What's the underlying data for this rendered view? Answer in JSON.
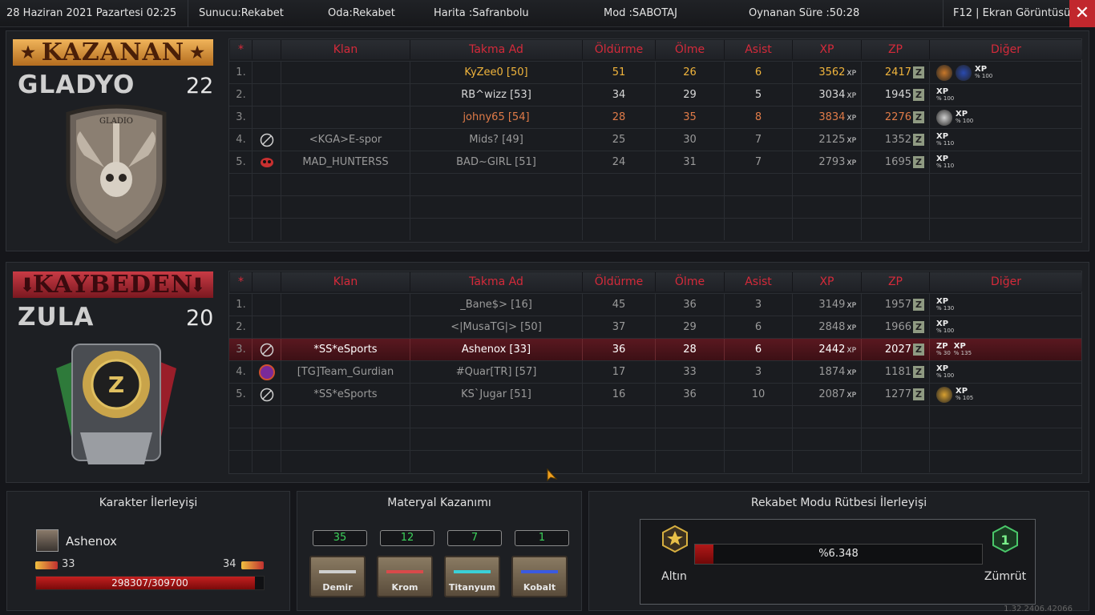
{
  "topbar": {
    "date": "28 Haziran 2021 Pazartesi 02:25",
    "server": "Sunucu:Rekabet",
    "room": "Oda:Rekabet",
    "map": "Harita :Safranbolu",
    "mode": "Mod :SABOTAJ",
    "time": "Oynanan Süre :50:28",
    "screenshot": "F12 | Ekran Görüntüsü",
    "close": "✕"
  },
  "headers": {
    "star": "*",
    "clan": "Klan",
    "nick": "Takma Ad",
    "kills": "Öldürme",
    "deaths": "Ölme",
    "assists": "Asist",
    "xp": "XP",
    "zp": "ZP",
    "other": "Diğer"
  },
  "winner": {
    "banner": "KAZANAN",
    "team": "GLADYO",
    "score": "22",
    "emblem_text": "GLADIO",
    "rows": [
      {
        "n": "1.",
        "clan": "",
        "nick": "KyZee0 [50]",
        "k": "51",
        "d": "26",
        "a": "6",
        "xp": "3562",
        "zp": "2417",
        "bonus": [
          {
            "t": "XP",
            "p": "% 100"
          }
        ],
        "medals": [
          "skull-medal",
          "star-medal"
        ],
        "color": "#f0b43c"
      },
      {
        "n": "2.",
        "clan": "",
        "nick": "RB^wizz [53]",
        "k": "34",
        "d": "29",
        "a": "5",
        "xp": "3034",
        "zp": "1945",
        "bonus": [
          {
            "t": "XP",
            "p": "% 100"
          }
        ],
        "medals": [],
        "color": "#d8d8d8"
      },
      {
        "n": "3.",
        "clan": "",
        "nick": "johny65 [54]",
        "k": "28",
        "d": "35",
        "a": "8",
        "xp": "3834",
        "zp": "2276",
        "bonus": [
          {
            "t": "XP",
            "p": "% 100"
          }
        ],
        "medals": [
          "rank-medal"
        ],
        "color": "#e07b48"
      },
      {
        "n": "4.",
        "clan": "<KGA>E-spor",
        "nick": "Mids? [49]",
        "k": "25",
        "d": "30",
        "a": "7",
        "xp": "2125",
        "zp": "1352",
        "bonus": [
          {
            "t": "XP",
            "p": "% 110"
          }
        ],
        "medals": [],
        "color": "#9a9a9a",
        "clanicon": "no-clan-icon"
      },
      {
        "n": "5.",
        "clan": "MAD_HUNTERSS",
        "nick": "BAD~GIRL [51]",
        "k": "24",
        "d": "31",
        "a": "7",
        "xp": "2793",
        "zp": "1695",
        "bonus": [
          {
            "t": "XP",
            "p": "% 110"
          }
        ],
        "medals": [],
        "color": "#9a9a9a",
        "clanicon": "skull-clan-icon"
      }
    ]
  },
  "loser": {
    "banner": "KAYBEDEN",
    "team": "ZULA",
    "score": "20",
    "rows": [
      {
        "n": "1.",
        "clan": "",
        "nick": "_Bane$> [16]",
        "k": "45",
        "d": "36",
        "a": "3",
        "xp": "3149",
        "zp": "1957",
        "bonus": [
          {
            "t": "XP",
            "p": "% 130"
          }
        ],
        "medals": [],
        "color": "#9a9a9a"
      },
      {
        "n": "2.",
        "clan": "",
        "nick": "<|MusaTG|> [50]",
        "k": "37",
        "d": "29",
        "a": "6",
        "xp": "2848",
        "zp": "1966",
        "bonus": [
          {
            "t": "XP",
            "p": "% 100"
          }
        ],
        "medals": [],
        "color": "#9a9a9a"
      },
      {
        "n": "3.",
        "clan": "*SS*eSports",
        "nick": "Ashenox [33]",
        "k": "36",
        "d": "28",
        "a": "6",
        "xp": "2442",
        "zp": "2027",
        "bonus": [
          {
            "t": "ZP",
            "p": "% 30"
          },
          {
            "t": "XP",
            "p": "% 135"
          }
        ],
        "medals": [],
        "color": "#ffffff",
        "clanicon": "no-clan-icon",
        "hl": true
      },
      {
        "n": "4.",
        "clan": "[TG]Team_Gurdian",
        "nick": "#Quar[TR] [57]",
        "k": "17",
        "d": "33",
        "a": "3",
        "xp": "1874",
        "zp": "1181",
        "bonus": [
          {
            "t": "XP",
            "p": "% 100"
          }
        ],
        "medals": [],
        "color": "#9a9a9a",
        "clanicon": "purple-clan-icon"
      },
      {
        "n": "5.",
        "clan": "*SS*eSports",
        "nick": "KS`Jugar [51]",
        "k": "16",
        "d": "36",
        "a": "10",
        "xp": "2087",
        "zp": "1277",
        "bonus": [
          {
            "t": "XP",
            "p": "% 105"
          }
        ],
        "medals": [
          "a-medal"
        ],
        "color": "#9a9a9a",
        "clanicon": "no-clan-icon"
      }
    ]
  },
  "character": {
    "title": "Karakter İlerleyişi",
    "name": "Ashenox",
    "level_current": "33",
    "level_next": "34",
    "xp_text": "298307/309700",
    "progress": 0.963
  },
  "material": {
    "title": "Materyal Kazanımı",
    "items": [
      {
        "name": "Demir",
        "count": "35",
        "color": "#cfcfcf"
      },
      {
        "name": "Krom",
        "count": "12",
        "color": "#d84a4a"
      },
      {
        "name": "Titanyum",
        "count": "7",
        "color": "#3ad0d8"
      },
      {
        "name": "Kobalt",
        "count": "1",
        "color": "#3a5ae0"
      }
    ]
  },
  "rank": {
    "title": "Rekabet Modu Rütbesi İlerleyişi",
    "from": "Altın",
    "to": "Zümrüt",
    "percent_text": "%6.348",
    "progress": 0.06348
  },
  "version": "1.32.2406.42066"
}
